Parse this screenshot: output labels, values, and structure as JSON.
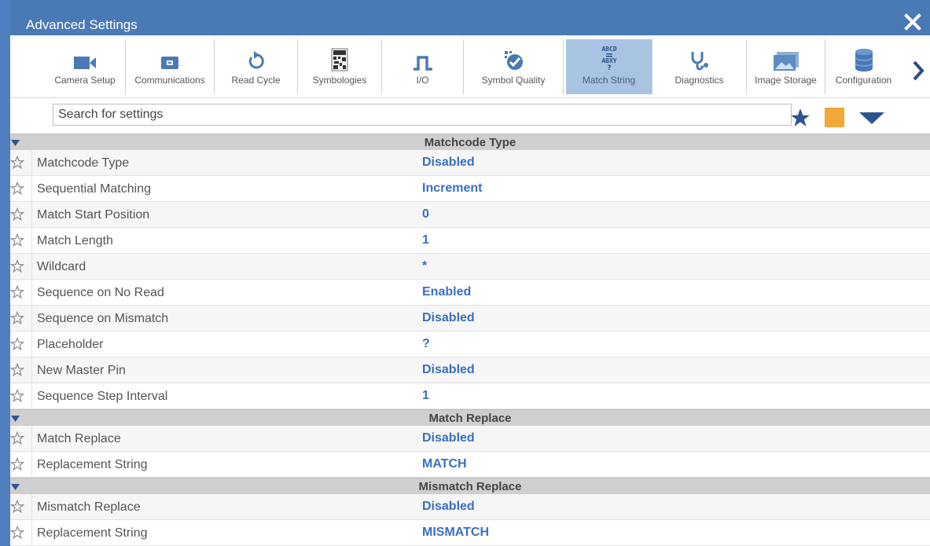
{
  "window": {
    "title": "Advanced Settings"
  },
  "toolbar": {
    "items": [
      {
        "label": "Camera Setup",
        "icon": "camera-icon"
      },
      {
        "label": "Communications",
        "icon": "communications-icon"
      },
      {
        "label": "Read Cycle",
        "icon": "read-cycle-icon"
      },
      {
        "label": "Symbologies",
        "icon": "symbologies-icon"
      },
      {
        "label": "I/O",
        "icon": "io-icon"
      },
      {
        "label": "Symbol Quality",
        "icon": "symbol-quality-icon"
      },
      {
        "label": "Match String",
        "icon": "match-string-icon",
        "active": true
      },
      {
        "label": "Diagnostics",
        "icon": "stethoscope-icon"
      },
      {
        "label": "Image Storage",
        "icon": "image-storage-icon"
      },
      {
        "label": "Configuration",
        "icon": "database-icon"
      }
    ]
  },
  "search": {
    "placeholder": "Search for settings"
  },
  "colors": {
    "accent": "#4a7ab5",
    "value": "#3a6fc0",
    "orange": "#f0a83a",
    "active_tab": "#a9c3e3"
  },
  "sections": [
    {
      "title": "Matchcode Type",
      "rows": [
        {
          "label": "Matchcode Type",
          "value": "Disabled"
        },
        {
          "label": "Sequential Matching",
          "value": "Increment"
        },
        {
          "label": "Match Start Position",
          "value": "0"
        },
        {
          "label": "Match Length",
          "value": "1"
        },
        {
          "label": "Wildcard",
          "value": "*"
        },
        {
          "label": "Sequence on No Read",
          "value": "Enabled"
        },
        {
          "label": "Sequence on Mismatch",
          "value": "Disabled"
        },
        {
          "label": "Placeholder",
          "value": "?"
        },
        {
          "label": "New Master Pin",
          "value": "Disabled"
        },
        {
          "label": "Sequence Step Interval",
          "value": "1"
        }
      ]
    },
    {
      "title": "Match Replace",
      "rows": [
        {
          "label": "Match Replace",
          "value": "Disabled"
        },
        {
          "label": "Replacement String",
          "value": "MATCH"
        }
      ]
    },
    {
      "title": "Mismatch Replace",
      "rows": [
        {
          "label": "Mismatch Replace",
          "value": "Disabled"
        },
        {
          "label": "Replacement String",
          "value": "MISMATCH"
        }
      ]
    }
  ]
}
